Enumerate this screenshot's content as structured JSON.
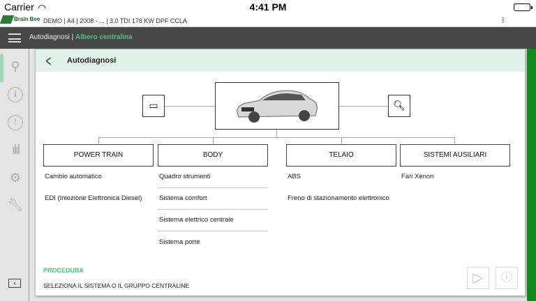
{
  "status": {
    "carrier": "Carrier",
    "time": "4:41 PM"
  },
  "header": {
    "logo": "Brain Bee",
    "vehicle": "DEMO | A4 | 2008 - ... | 3.0 TDI 176 KW DPF CCLA"
  },
  "nav": {
    "section": "Autodiagnosi",
    "separator": " | ",
    "current": "Albero centralina"
  },
  "sidebar": {
    "items": [
      "tree-icon",
      "info-icon",
      "alert-icon",
      "chart-icon",
      "gear-icon",
      "wrench-icon"
    ]
  },
  "panel": {
    "title": "Autodiagnosi"
  },
  "categories": [
    {
      "label": "POWER TRAIN",
      "items": [
        "Cambio automatico",
        "EDI (Iniezione Elettronica Diesel)"
      ]
    },
    {
      "label": "BODY",
      "items": [
        "Quadro strumenti",
        "Sistema comfort",
        "Sistema elettrico centrale",
        "Sistema porte"
      ]
    },
    {
      "label": "TELAIO",
      "items": [
        "ABS",
        "Freno di stazionamento elettronico"
      ]
    },
    {
      "label": "SISTEMI AUSILIARI",
      "items": [
        "Fari Xenon"
      ]
    }
  ],
  "procedure": {
    "label": "PROCEDURA",
    "text": "SELEZIONA IL SISTEMA O IL GRUPPO CENTRALINE"
  }
}
